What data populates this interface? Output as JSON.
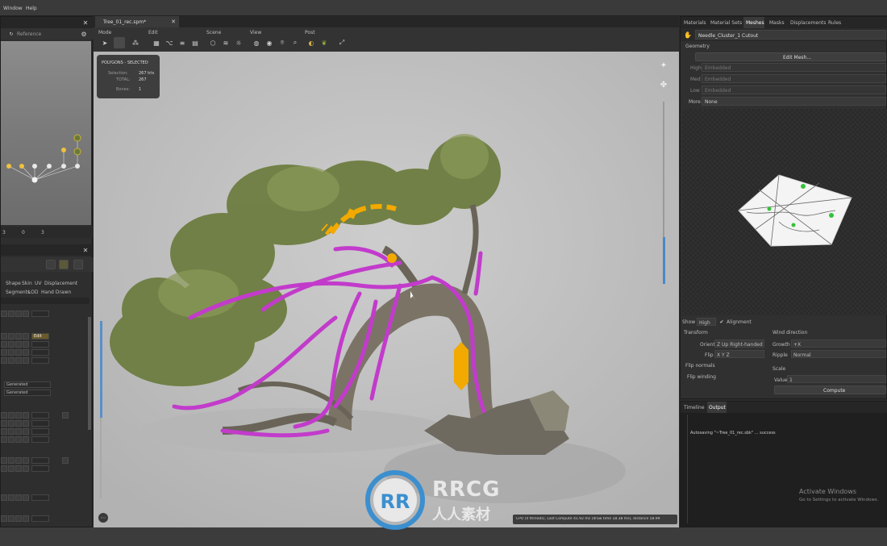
{
  "menu": {
    "window": "Window",
    "help": "Help"
  },
  "left_panel": {
    "partial_label": "Reference",
    "counts": [
      "3",
      "0",
      "3"
    ],
    "tabs": [
      "Shape",
      "Skin",
      "UV",
      "Displacement"
    ],
    "tabs2": [
      "Segments",
      "LOD",
      "Hand Drawn"
    ],
    "select_values": [
      "Generated",
      "Generated"
    ],
    "edit_tag": "Edit"
  },
  "doc_tab": {
    "label": "Tree_01_rec.spm*"
  },
  "toolbar": {
    "groups": [
      "Mode",
      "Edit",
      "Scene",
      "View",
      "Post"
    ]
  },
  "viewport": {
    "info_header": "POLYGONS - SELECTED",
    "selection_label": "Selection:",
    "selection_value": "267 tris",
    "total_label": "TOTAL:",
    "total_value": "267",
    "bones_label": "Bones:",
    "bones_value": "1",
    "status_text": "CPU (4 threads), Last Compute 41.92 ms (draw time 18.38 ms), distance 58.99",
    "fps_icon": "more-icon"
  },
  "right_panel": {
    "tabs": [
      "Materials",
      "Material Sets",
      "Meshes",
      "Masks",
      "Displacements",
      "Rules"
    ],
    "active_tab": "Meshes",
    "mesh_name": "Needle_Cluster_1 Cutout",
    "section_geometry": "Geometry",
    "edit_mesh_button": "Edit Mesh...",
    "lod_rows": [
      {
        "label": "High",
        "value": "Embedded"
      },
      {
        "label": "Med",
        "value": "Embedded"
      },
      {
        "label": "Low",
        "value": "Embedded"
      },
      {
        "label": "More",
        "value": "None"
      }
    ],
    "show_label": "Show",
    "show_value": "High",
    "alignment_label": "Alignment",
    "transform_label": "Transform",
    "orient_label": "Orient",
    "orient_value": "Z Up Right-handed",
    "flip_label": "Flip",
    "flip_value": "X Y Z",
    "flip_normals": "Flip normals",
    "flip_winding": "Flip winding",
    "wind_direction": "Wind direction",
    "growth_label": "Growth",
    "growth_value": "+X",
    "ripple_label": "Ripple",
    "ripple_value": "Normal",
    "scale_label": "Scale",
    "scale_value_label": "Value",
    "scale_value": "1",
    "compute_button": "Compute",
    "bottom_tabs": [
      "Timeline",
      "Output"
    ],
    "output_line": "Autosaving \"~Tree_01_rec.sbk\" ... success",
    "activate_title": "Activate Windows",
    "activate_sub": "Go to Settings to activate Windows."
  },
  "watermark": {
    "title": "RRCG",
    "sub": "人人素材"
  },
  "colors": {
    "accent": "#f2a900",
    "selection": "#c23bcb",
    "panel": "#303030",
    "viewport": "#c2c2c2"
  }
}
